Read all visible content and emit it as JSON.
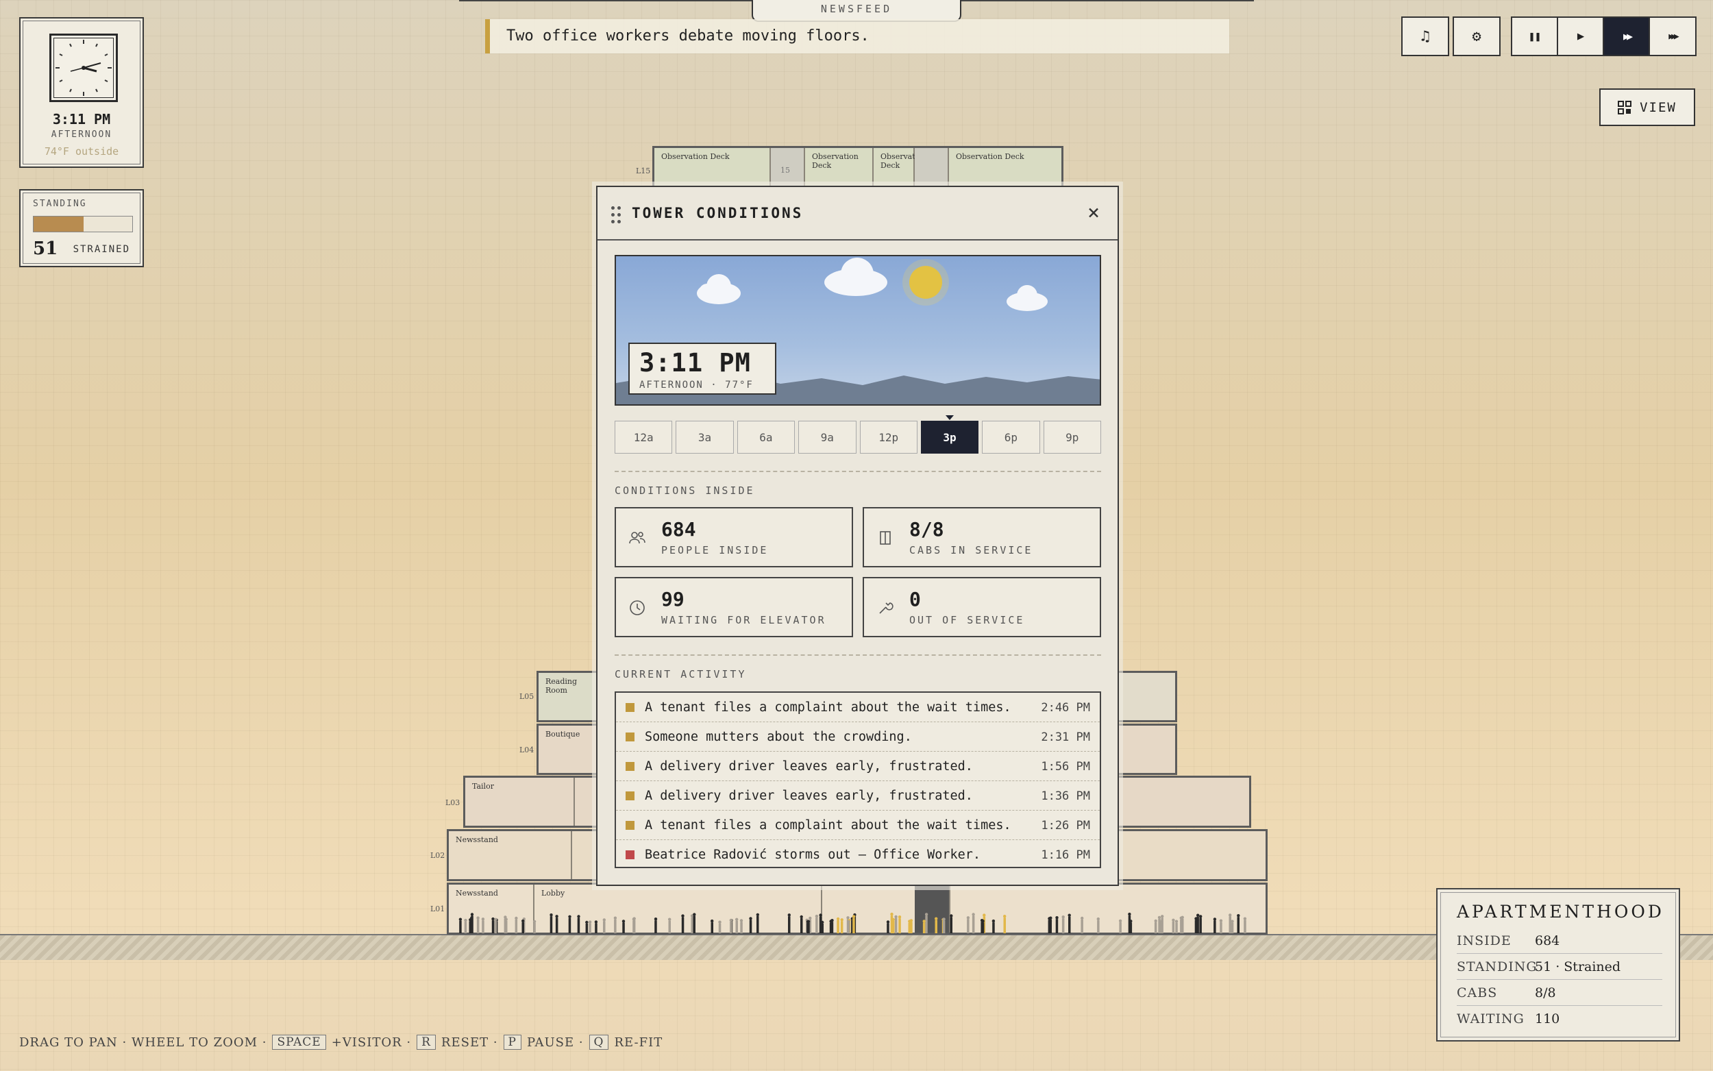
{
  "clock": {
    "time": "3:11 PM",
    "period": "AFTERNOON",
    "temp": "74°F outside"
  },
  "standing": {
    "label": "STANDING",
    "value": "51",
    "status": "STRAINED",
    "fill_fraction": 0.51
  },
  "newsfeed": {
    "tab": "NEWSFEED",
    "message": "Two office workers debate moving floors."
  },
  "toolbar": {
    "buttons": [
      {
        "name": "music-icon",
        "glyph": "♫"
      },
      {
        "name": "settings-icon",
        "glyph": "⚙"
      }
    ],
    "speed": [
      {
        "name": "pause-icon",
        "glyph": "❚❚"
      },
      {
        "name": "play-icon",
        "glyph": "▶"
      },
      {
        "name": "fast-forward-icon",
        "glyph": "▶▶",
        "active": true
      },
      {
        "name": "fastest-forward-icon",
        "glyph": "▶▶▶"
      }
    ],
    "view_label": "VIEW"
  },
  "building": {
    "top_rooms": [
      "Observation Deck",
      "Observation Deck",
      "Observation Deck",
      "Observation Deck"
    ],
    "elevator_number": "15",
    "rooms": {
      "reading": "Reading Room",
      "boutique": "Boutique",
      "tailor": "Tailor",
      "newsstand": "Newsstand",
      "lobby": "Lobby"
    }
  },
  "modal": {
    "title": "TOWER CONDITIONS",
    "close": "×",
    "sky_time": "3:11 PM",
    "sky_sub": "AFTERNOON · 77°F",
    "hours": [
      "12a",
      "3a",
      "6a",
      "9a",
      "12p",
      "3p",
      "6p",
      "9p"
    ],
    "active_hour": "3p",
    "conditions_label": "CONDITIONS INSIDE",
    "stats": [
      {
        "value": "684",
        "label": "PEOPLE INSIDE",
        "icon": "people-icon"
      },
      {
        "value": "8/8",
        "label": "CABS IN SERVICE",
        "icon": "elevator-icon"
      },
      {
        "value": "99",
        "label": "WAITING FOR ELEVATOR",
        "icon": "clock-icon"
      },
      {
        "value": "0",
        "label": "OUT OF SERVICE",
        "icon": "wrench-icon"
      }
    ],
    "activity_label": "CURRENT ACTIVITY",
    "activity": [
      {
        "text": "A tenant files a complaint about the wait times.",
        "time": "2:46 PM",
        "color": "#c0983c"
      },
      {
        "text": "Someone mutters about the crowding.",
        "time": "2:31 PM",
        "color": "#c0983c"
      },
      {
        "text": "A delivery driver leaves early, frustrated.",
        "time": "1:56 PM",
        "color": "#c0983c"
      },
      {
        "text": "A delivery driver leaves early, frustrated.",
        "time": "1:36 PM",
        "color": "#c0983c"
      },
      {
        "text": "A tenant files a complaint about the wait times.",
        "time": "1:26 PM",
        "color": "#c0983c"
      },
      {
        "text": "Beatrice Radović storms out — Office Worker.",
        "time": "1:16 PM",
        "color": "#c0484a"
      }
    ]
  },
  "hints": {
    "drag": "DRAG TO PAN · WHEEL TO ZOOM ·",
    "space_key": "SPACE",
    "space_text": "+VISITOR ·",
    "r_key": "R",
    "r_text": "RESET ·",
    "p_key": "P",
    "p_text": "PAUSE ·",
    "q_key": "Q",
    "q_text": "RE-FIT"
  },
  "summary": {
    "title": "APARTMENTHOOD",
    "rows": [
      {
        "k": "INSIDE",
        "v": "684"
      },
      {
        "k": "STANDING",
        "v": "51 · Strained"
      },
      {
        "k": "CABS",
        "v": "8/8"
      },
      {
        "k": "WAITING",
        "v": "110"
      }
    ]
  },
  "colors": {
    "accent_dark": "#1e2230",
    "gold": "#c0983c",
    "alert": "#c0484a",
    "standing_fill": "#b88c50"
  }
}
